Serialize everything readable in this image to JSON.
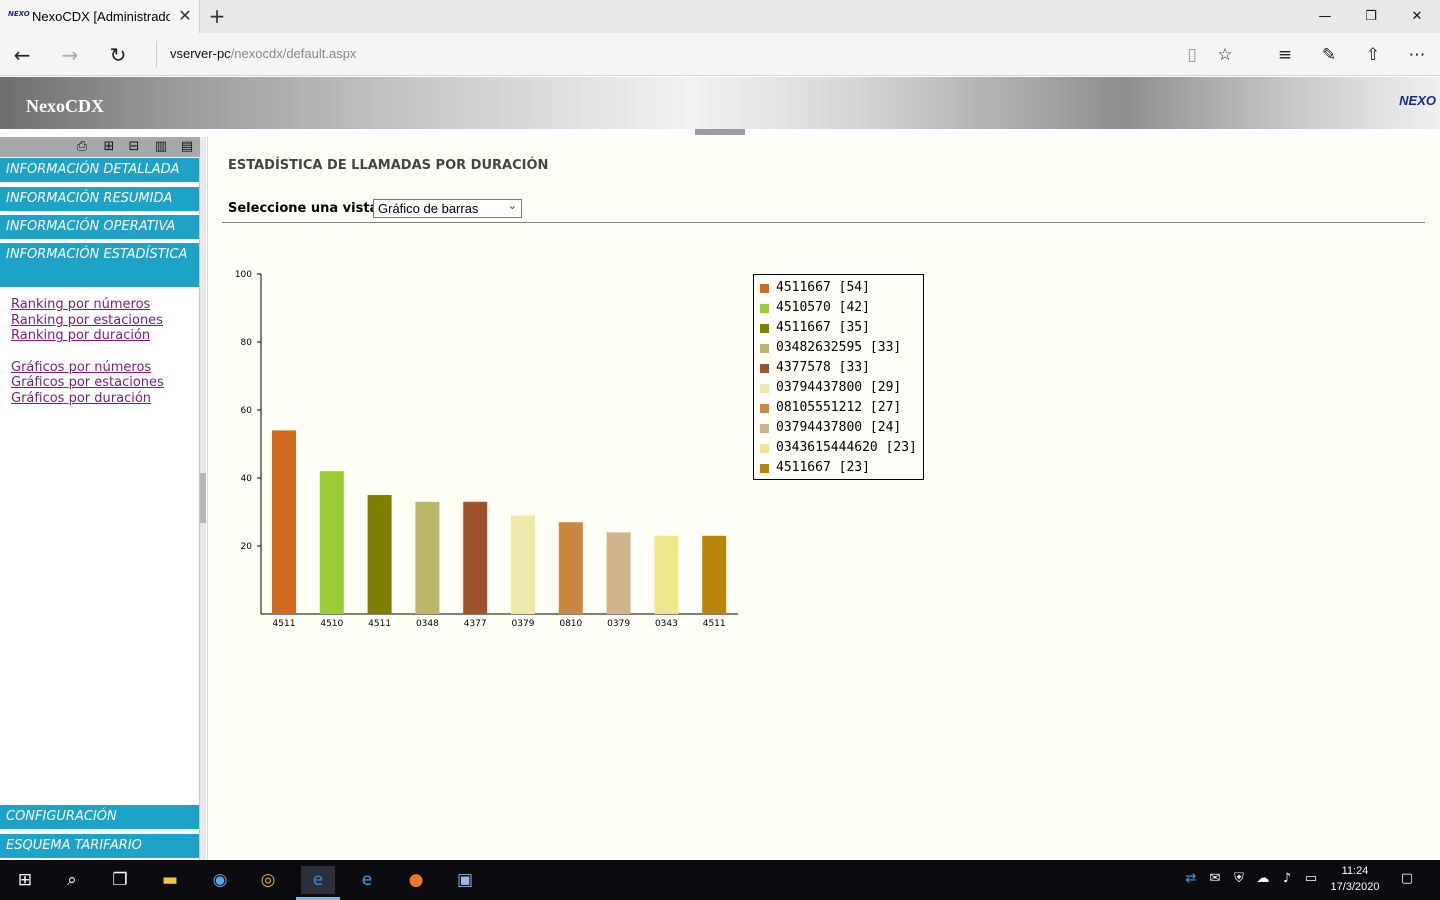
{
  "browser": {
    "tab_title": "NexoCDX [Administrador]",
    "tab_favicon": "NEXO",
    "url_host": "vserver-pc",
    "url_path": "/nexocdx/default.aspx"
  },
  "app": {
    "title": "NexoCDX",
    "logo": "NEXO"
  },
  "sidebar": {
    "toolbar_icons": [
      "print-icon",
      "expand-icon",
      "collapse-icon",
      "book-icon",
      "notes-icon"
    ],
    "sections_top": [
      {
        "label": "INFORMACIÓN DETALLADA"
      },
      {
        "label": "INFORMACIÓN RESUMIDA"
      },
      {
        "label": "INFORMACIÓN OPERATIVA"
      },
      {
        "label": "INFORMACIÓN ESTADÍSTICA"
      }
    ],
    "links": [
      {
        "label": "Ranking por números"
      },
      {
        "label": "Ranking por estaciones"
      },
      {
        "label": "Ranking por duración"
      },
      {
        "label": "Gráficos por números"
      },
      {
        "label": "Gráficos por estaciones"
      },
      {
        "label": "Gráficos por duración"
      }
    ],
    "sections_bottom": [
      {
        "label": "CONFIGURACIÓN"
      },
      {
        "label": "ESQUEMA TARIFARIO"
      }
    ]
  },
  "main": {
    "title": "ESTADÍSTICA DE LLAMADAS POR DURACIÓN",
    "view_label": "Seleccione una vista:",
    "view_selected": "Gráfico de barras"
  },
  "chart_data": {
    "type": "bar",
    "categories": [
      "4511",
      "4510",
      "4511",
      "0348",
      "4377",
      "0379",
      "0810",
      "0379",
      "0343",
      "4511"
    ],
    "values": [
      54,
      42,
      35,
      33,
      33,
      29,
      27,
      24,
      23,
      23
    ],
    "colors": [
      "#d2691e",
      "#9acd32",
      "#808000",
      "#bdb76b",
      "#a0522d",
      "#eee8aa",
      "#cd853f",
      "#d2b48c",
      "#f0e68c",
      "#b8860b"
    ],
    "ylim": [
      0,
      100
    ],
    "yticks": [
      20,
      40,
      60,
      80,
      100
    ],
    "legend": [
      "4511667  [54]",
      "4510570  [42]",
      "4511667  [35]",
      "03482632595  [33]",
      "4377578  [33]",
      "03794437800  [29]",
      "08105551212  [27]",
      "03794437800  [24]",
      "0343615444620  [23]",
      "4511667  [23]"
    ],
    "legend_position": "right"
  },
  "taskbar": {
    "time": "11:24",
    "date": "17/3/2020"
  }
}
